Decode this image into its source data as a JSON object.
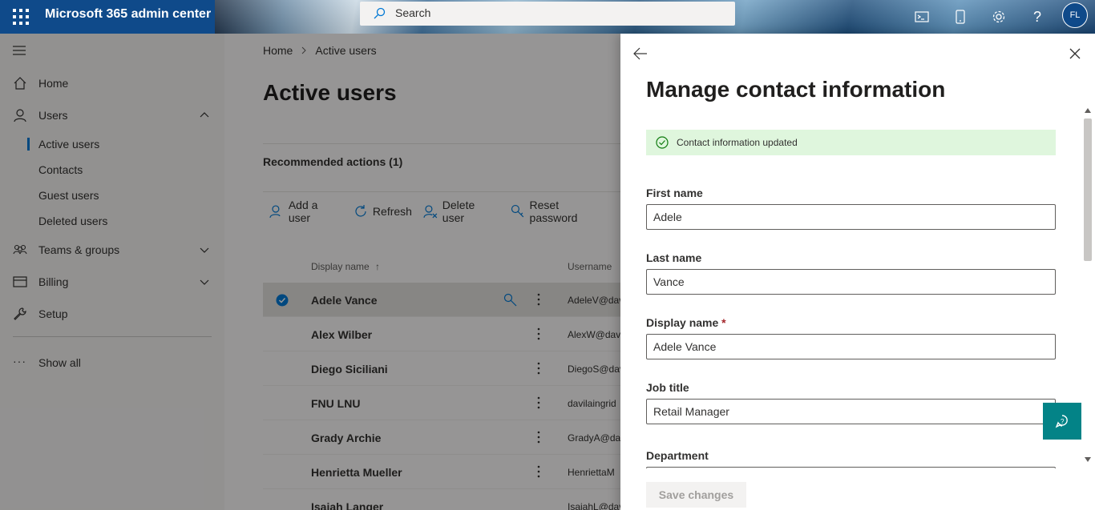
{
  "header": {
    "app_title": "Microsoft 365 admin center",
    "search_placeholder": "Search",
    "avatar_initials": "FL"
  },
  "nav": {
    "home": "Home",
    "users": "Users",
    "active_users": "Active users",
    "contacts": "Contacts",
    "guest_users": "Guest users",
    "deleted_users": "Deleted users",
    "teams_groups": "Teams & groups",
    "billing": "Billing",
    "setup": "Setup",
    "show_all": "Show all"
  },
  "main": {
    "breadcrumb_home": "Home",
    "breadcrumb_current": "Active users",
    "title": "Active users",
    "recommended": "Recommended actions (1)",
    "commands": {
      "add_user": "Add a user",
      "refresh": "Refresh",
      "delete_user": "Delete user",
      "reset_password": "Reset password"
    },
    "columns": {
      "display_name": "Display name",
      "username": "Username"
    },
    "rows": [
      {
        "name": "Adele Vance",
        "username": "AdeleV@dav"
      },
      {
        "name": "Alex Wilber",
        "username": "AlexW@davi"
      },
      {
        "name": "Diego Siciliani",
        "username": "DiegoS@dav"
      },
      {
        "name": "FNU LNU",
        "username": "davilaingrid"
      },
      {
        "name": "Grady Archie",
        "username": "GradyA@dav"
      },
      {
        "name": "Henrietta Mueller",
        "username": "HenriettaM"
      },
      {
        "name": "Isaiah Langer",
        "username": "IsaiahL@dav"
      }
    ]
  },
  "panel": {
    "title": "Manage contact information",
    "message": "Contact information updated",
    "first_name_label": "First name",
    "first_name_value": "Adele",
    "last_name_label": "Last name",
    "last_name_value": "Vance",
    "display_name_label": "Display name",
    "required_mark": "*",
    "display_name_value": "Adele Vance",
    "job_title_label": "Job title",
    "job_title_value": "Retail Manager",
    "department_label": "Department",
    "save_label": "Save changes"
  },
  "colors": {
    "accent": "#0078d4",
    "success_bg": "#dff6dd",
    "help_button": "#038387"
  }
}
